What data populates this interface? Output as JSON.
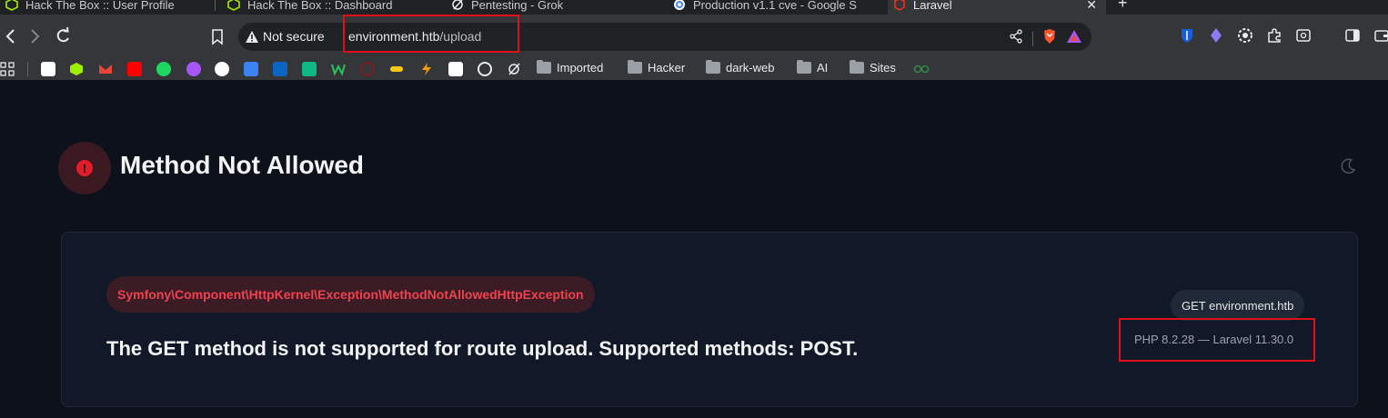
{
  "browser": {
    "tabs": [
      {
        "title": "Hack The Box :: User Profile",
        "active": false
      },
      {
        "title": "Hack The Box :: Dashboard",
        "active": false
      },
      {
        "title": "Pentesting - Grok",
        "active": false
      },
      {
        "title": "Production v1.1 cve - Google S",
        "active": false
      },
      {
        "title": "Laravel",
        "active": true
      }
    ],
    "security_label": "Not secure",
    "url_host": "environment.htb",
    "url_path": "/upload",
    "bookmark_folders": [
      "Imported",
      "Hacker",
      "dark-web",
      "AI",
      "Sites"
    ]
  },
  "colors": {
    "page_bg": "#0c111b",
    "card_bg": "#111827",
    "danger": "#e11d2a",
    "annotation_red": "#e0101a"
  },
  "page": {
    "title": "Method Not Allowed",
    "exception_class": "Symfony\\Component\\HttpKernel\\Exception\\MethodNotAllowedHttpException",
    "message": "The GET method is not supported for route upload. Supported methods: POST.",
    "request_label": "GET environment.htb",
    "version_label": "PHP 8.2.28 — Laravel 11.30.0"
  }
}
